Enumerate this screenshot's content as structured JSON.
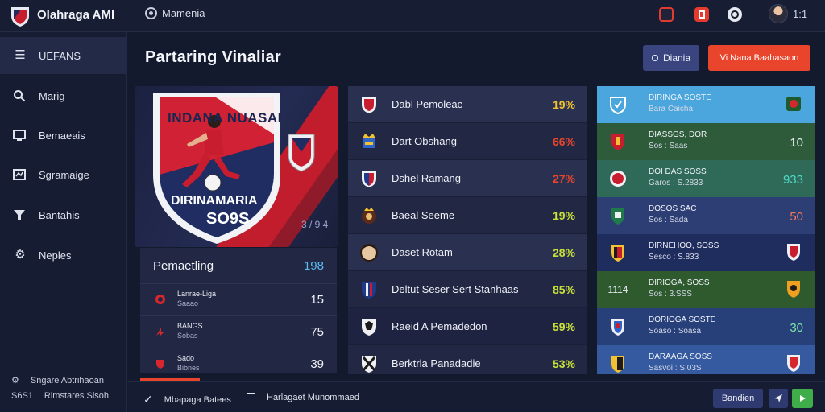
{
  "app": {
    "name": "Olahraga AMI",
    "user_value": "1:1"
  },
  "top_nav": {
    "label": "Mamenia"
  },
  "colors": {
    "accent": "#e8452c",
    "background": "#141a2e",
    "primary_blue": "#3a4580",
    "highlight_cyan": "#5cb8f0"
  },
  "sidebar": {
    "items": [
      {
        "label": "UEFANS",
        "icon": "menu-icon"
      },
      {
        "label": "Marig",
        "icon": "search-icon"
      },
      {
        "label": "Bemaeais",
        "icon": "monitor-icon"
      },
      {
        "label": "Sgramaige",
        "icon": "chart-icon"
      },
      {
        "label": "Bantahis",
        "icon": "funnel-icon"
      },
      {
        "label": "Neples",
        "icon": "gear-icon"
      }
    ],
    "footer": [
      {
        "label": "Sngare Abtrihaoan",
        "icon": "settings-icon"
      },
      {
        "label": "Rimstares Sisoh",
        "prefix": "S6S1"
      }
    ]
  },
  "header": {
    "title": "Partaring Vinaliar",
    "secondary_button": "Diania",
    "primary_button": "Vi Nana Baahasaon"
  },
  "hero": {
    "crest_text_top": "INDANA NUASAI",
    "crest_text_bottom": "DIRINAMARIA",
    "crest_year": "SO9S",
    "badge_value": "3 / 9 4"
  },
  "ranking": {
    "title": "Pemaetling",
    "value": "198",
    "rows": [
      {
        "name": "Lanrae-Liga",
        "sub": "Saaao",
        "value": "15",
        "icon": "red-circle-icon"
      },
      {
        "name": "BANGS",
        "sub": "Sobas",
        "value": "75",
        "icon": "lightning-icon"
      },
      {
        "name": "Sado",
        "sub": "Bibnes",
        "value": "39",
        "icon": "shield-icon"
      }
    ]
  },
  "middle_list": [
    {
      "name": "Dabl Pemoleac",
      "value": "19%",
      "color": "#f2c233",
      "icon": "red-shield-icon"
    },
    {
      "name": "Dart Obshang",
      "value": "66%",
      "color": "#e8452c",
      "icon": "crown-crest-icon"
    },
    {
      "name": "Dshel Ramang",
      "value": "27%",
      "color": "#e8452c",
      "icon": "blue-red-shield-icon"
    },
    {
      "name": "Baeal Seeme",
      "value": "19%",
      "color": "#c8e03a",
      "icon": "dark-crest-icon"
    },
    {
      "name": "Daset Rotam",
      "value": "28%",
      "color": "#c8e03a",
      "icon": "player-photo-icon"
    },
    {
      "name": "Deltut Seser Sert Stanhaas",
      "value": "85%",
      "color": "#c8e03a",
      "icon": "stripe-shield-icon"
    },
    {
      "name": "Raeid A Pemadedon",
      "value": "59%",
      "color": "#c8e03a",
      "icon": "eagle-crest-icon"
    },
    {
      "name": "Berktrla Panadadie",
      "value": "53%",
      "color": "#c8e03a",
      "icon": "cross-crest-icon"
    }
  ],
  "right_list": [
    {
      "title": "DIRINGA SOSTE",
      "sub": "Bara Caicha",
      "lead": "",
      "value": "",
      "bg": "#4aa6dc",
      "icon": "green-crest-icon",
      "value_color": "#ffffff"
    },
    {
      "title": "DIASSGS, DOR",
      "sub": "Sos : Saas",
      "lead": "",
      "value": "10",
      "bg": "#2e5b3a",
      "icon": "",
      "value_color": "#f2f4fa"
    },
    {
      "title": "DOI DAS SOSS",
      "sub": "Garos : S.2833",
      "lead": "",
      "value": "933",
      "bg": "#2f6a58",
      "icon": "",
      "value_color": "#4fd8c8"
    },
    {
      "title": "DOSOS SAC",
      "sub": "Sos : Sada",
      "lead": "",
      "value": "50",
      "bg": "#2d3e74",
      "icon": "",
      "value_color": "#f07a5a"
    },
    {
      "title": "DIRNEHOO, SOSS",
      "sub": "Sesco : S.833",
      "lead": "",
      "value": "",
      "bg": "#1f2c5e",
      "icon": "shield-icon",
      "value_color": "#ffffff"
    },
    {
      "title": "DIRIOGA, SOSS",
      "sub": "Sos : 3.SSS",
      "lead": "1114",
      "value": "",
      "bg": "#2e5a2e",
      "icon": "orange-crest-icon",
      "value_color": "#ffffff"
    },
    {
      "title": "DORIOGA SOSTE",
      "sub": "Soaso : Soasa",
      "lead": "",
      "value": "30",
      "bg": "#27407a",
      "icon": "",
      "value_color": "#7be7a8"
    },
    {
      "title": "DARAAGA SOSS",
      "sub": "Sasvoi : S.03S",
      "lead": "",
      "value": "",
      "bg": "#355aa0",
      "icon": "red-crest-icon",
      "value_color": "#ffffff"
    }
  ],
  "bottom": {
    "item1": "Mbapaga Batees",
    "item2": "Harlagaet Munommaed",
    "button1": "Bandien",
    "button2_icon": "send-icon",
    "button3_icon": "play-icon"
  }
}
